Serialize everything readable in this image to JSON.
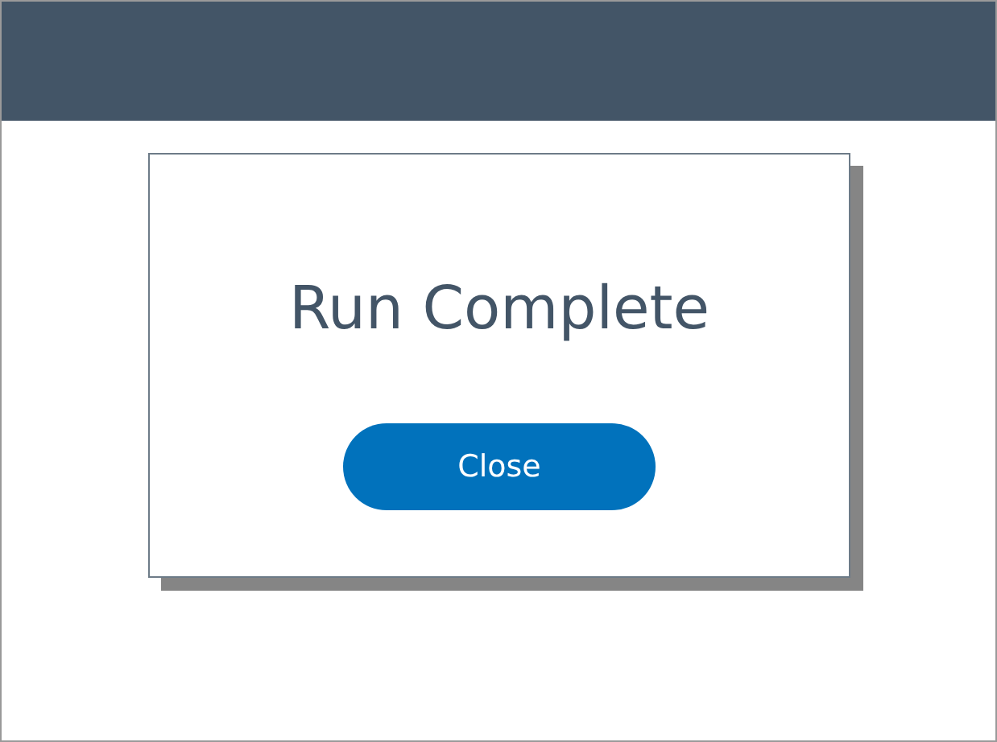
{
  "dialog": {
    "title": "Run Complete",
    "buttons": [
      "Close"
    ]
  }
}
